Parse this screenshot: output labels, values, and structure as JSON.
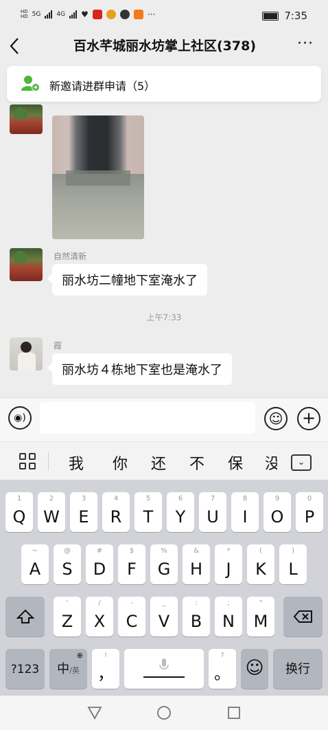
{
  "status_bar": {
    "left_labels": [
      "5G",
      "4G"
    ],
    "time": "7:35"
  },
  "header": {
    "title": "百水芊城丽水坊掌上社区(378)",
    "more": "···"
  },
  "notice": {
    "text": "新邀请进群申请（5）"
  },
  "messages": [
    {
      "type": "image",
      "sender": ""
    },
    {
      "type": "text",
      "sender": "自然清新",
      "text": "丽水坊二幢地下室淹水了"
    },
    {
      "type": "time",
      "text": "上午7:33"
    },
    {
      "type": "text",
      "sender": "霞",
      "text": "丽水坊４栋地下室也是淹水了"
    }
  ],
  "input": {
    "value": "",
    "placeholder": ""
  },
  "suggestions": [
    "我",
    "你",
    "还",
    "不",
    "保",
    "没"
  ],
  "keyboard": {
    "row1": [
      {
        "sub": "1",
        "key": "Q"
      },
      {
        "sub": "2",
        "key": "W"
      },
      {
        "sub": "3",
        "key": "E"
      },
      {
        "sub": "4",
        "key": "R"
      },
      {
        "sub": "5",
        "key": "T"
      },
      {
        "sub": "6",
        "key": "Y"
      },
      {
        "sub": "7",
        "key": "U"
      },
      {
        "sub": "8",
        "key": "I"
      },
      {
        "sub": "9",
        "key": "O"
      },
      {
        "sub": "0",
        "key": "P"
      }
    ],
    "row2": [
      {
        "sub": "~",
        "key": "A"
      },
      {
        "sub": "@",
        "key": "S"
      },
      {
        "sub": "#",
        "key": "D"
      },
      {
        "sub": "$",
        "key": "F"
      },
      {
        "sub": "%",
        "key": "G"
      },
      {
        "sub": "&",
        "key": "H"
      },
      {
        "sub": "*",
        "key": "J"
      },
      {
        "sub": "(",
        "key": "K"
      },
      {
        "sub": ")",
        "key": "L"
      }
    ],
    "row3": [
      {
        "sub": "'",
        "key": "Z"
      },
      {
        "sub": "/",
        "key": "X"
      },
      {
        "sub": "-",
        "key": "C"
      },
      {
        "sub": "_",
        "key": "V"
      },
      {
        "sub": ":",
        "key": "B"
      },
      {
        "sub": ";",
        "key": "N"
      },
      {
        "sub": "\"",
        "key": "M"
      }
    ],
    "num_key": "?123",
    "lang_key": "中",
    "lang_sub": "/英",
    "comma_sub": "!",
    "comma": "，",
    "period_sub": "?",
    "period": "。",
    "enter": "换行"
  }
}
